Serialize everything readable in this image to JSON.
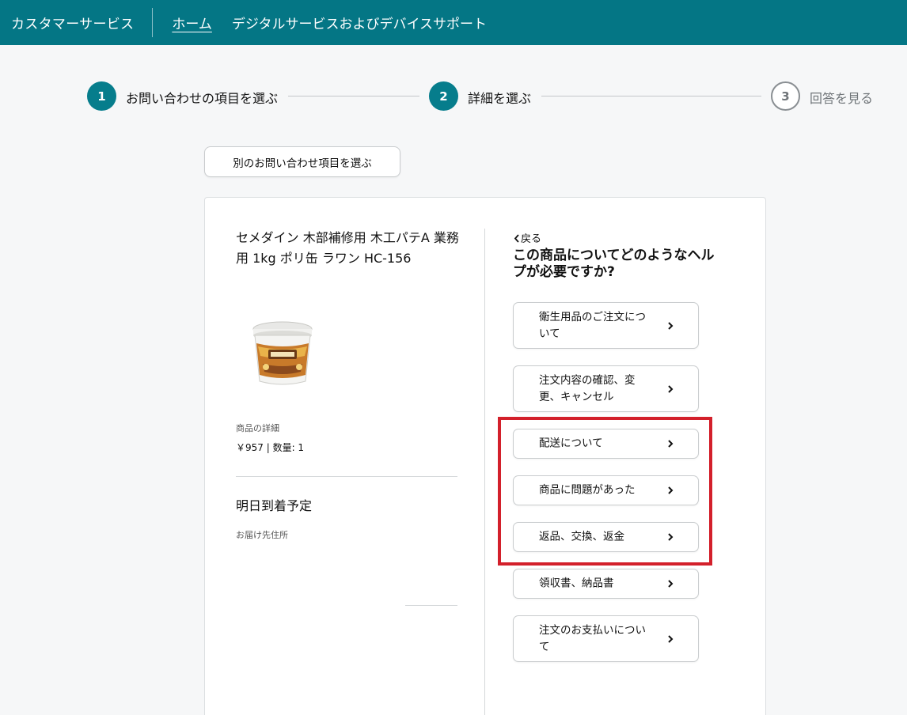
{
  "header": {
    "brand": "カスタマーサービス",
    "home_link": "ホーム",
    "section": "デジタルサービスおよびデバイスサポート"
  },
  "stepper": {
    "steps": [
      {
        "number": "1",
        "label": "お問い合わせの項目を選ぶ",
        "state": "complete"
      },
      {
        "number": "2",
        "label": "詳細を選ぶ",
        "state": "current"
      },
      {
        "number": "3",
        "label": "回答を見る",
        "state": "upcoming"
      }
    ]
  },
  "choose_other_button": "別のお問い合わせ項目を選ぶ",
  "product": {
    "title": "セメダイン 木部補修用 木工パテA 業務用 1kg ポリ缶 ラワン HC-156",
    "image_icon": "putty-container-image",
    "details_label": "商品の詳細",
    "price_quantity": "￥957 | 数量: 1",
    "arrival": "明日到着予定",
    "address_label": "お届け先住所"
  },
  "help": {
    "back_label": "戻る",
    "question": "この商品についてどのようなヘルプが必要ですか?",
    "options": [
      "衛生用品のご注文について",
      "注文内容の確認、変更、キャンセル",
      "配送について",
      "商品に問題があった",
      "返品、交換、返金",
      "領収書、納品書",
      "注文のお支払いについて"
    ]
  },
  "colors": {
    "header_bg": "#047685",
    "step_active": "#067d8c",
    "highlight_border": "#d3202b"
  }
}
